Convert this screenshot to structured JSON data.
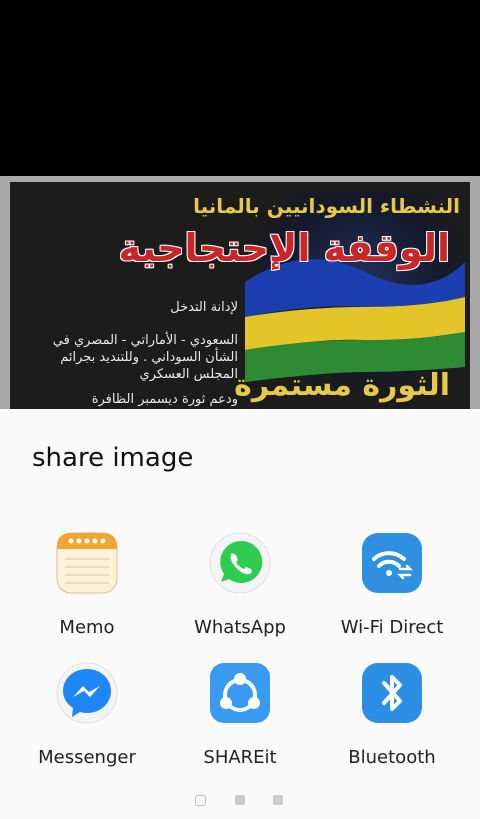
{
  "share_sheet": {
    "title": "share image",
    "apps": [
      {
        "label": "Memo",
        "icon": "memo-icon"
      },
      {
        "label": "WhatsApp",
        "icon": "whatsapp-icon"
      },
      {
        "label": "Wi-Fi Direct",
        "icon": "wifi-direct-icon"
      },
      {
        "label": "Messenger",
        "icon": "messenger-icon"
      },
      {
        "label": "SHAREit",
        "icon": "shareit-icon"
      },
      {
        "label": "Bluetooth",
        "icon": "bluetooth-icon"
      }
    ],
    "page_count": 3,
    "current_page": 1
  },
  "preview": {
    "lines": [
      "النشطاء السودانيين بالمانيا",
      "الوقفة الإحتجاجية",
      "لإدانة التدخل",
      "السعودي - الأماراتي - المصري في الشأن السوداني . وللتنديد بجرائم المجلس العسكري",
      "ودعم ثورة ديسمبر الظافرة",
      "الثورة مستمرة"
    ]
  },
  "colors": {
    "whatsapp": "#2ecc52",
    "wifi_direct": "#2f8fe0",
    "messenger": "#1e86f6",
    "shareit": "#3a9af0",
    "bluetooth": "#2d8ee6",
    "memo": "#f2a533"
  }
}
